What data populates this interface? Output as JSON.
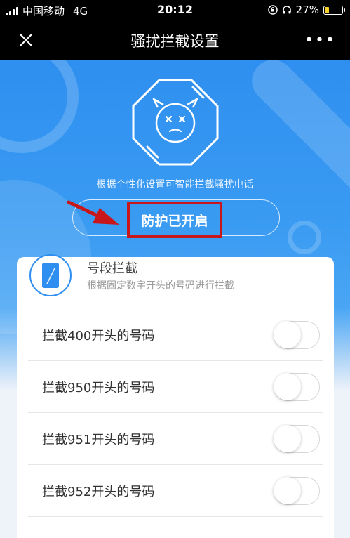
{
  "status_bar": {
    "carrier": "中国移动",
    "network": "4G",
    "time": "20:12",
    "battery_percent": "27%",
    "battery_level": 0.27
  },
  "nav": {
    "title": "骚扰拦截设置",
    "close_icon": "close-icon",
    "more_icon": "more-icon",
    "more_glyph": "•••"
  },
  "hero": {
    "subtitle": "根据个性化设置可智能拦截骚扰电话",
    "protection_label": "防护已开启",
    "mascot_icon": "shield-mascot-icon",
    "annotation_color": "#c8171b"
  },
  "segment": {
    "title": "号段拦截",
    "description": "根据固定数字开头的号码进行拦截",
    "icon": "phone-icon"
  },
  "rules": [
    {
      "label": "拦截400开头的号码",
      "enabled": false
    },
    {
      "label": "拦截950开头的号码",
      "enabled": false
    },
    {
      "label": "拦截951开头的号码",
      "enabled": false
    },
    {
      "label": "拦截952开头的号码",
      "enabled": false
    }
  ],
  "colors": {
    "accent": "#2f8ff0",
    "nav_background": "#000000"
  }
}
